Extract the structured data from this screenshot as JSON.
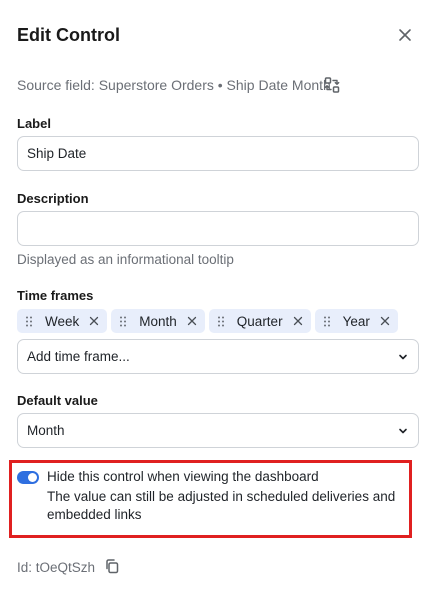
{
  "dialog": {
    "title": "Edit Control",
    "source": "Source field: Superstore Orders • Ship Date Month"
  },
  "label_field": {
    "label": "Label",
    "value": "Ship Date"
  },
  "description_field": {
    "label": "Description",
    "value": "",
    "help": "Displayed as an informational tooltip"
  },
  "time_frames": {
    "label": "Time frames",
    "chips": [
      "Week",
      "Month",
      "Quarter",
      "Year"
    ],
    "add_placeholder": "Add time frame..."
  },
  "default_value": {
    "label": "Default value",
    "value": "Month"
  },
  "hide_toggle": {
    "on": true,
    "label": "Hide this control when viewing the dashboard",
    "description": "The value can still be adjusted in scheduled deliveries and embedded links"
  },
  "footer": {
    "id_text": "Id: tOeQtSzh"
  },
  "colors": {
    "accent": "#2f6fe0",
    "chip_bg": "#e8eefb",
    "highlight": "#e02020"
  },
  "icons": [
    "close-icon",
    "swap-icon",
    "drag-handle-icon",
    "remove-icon",
    "chevron-down-icon",
    "copy-icon"
  ]
}
